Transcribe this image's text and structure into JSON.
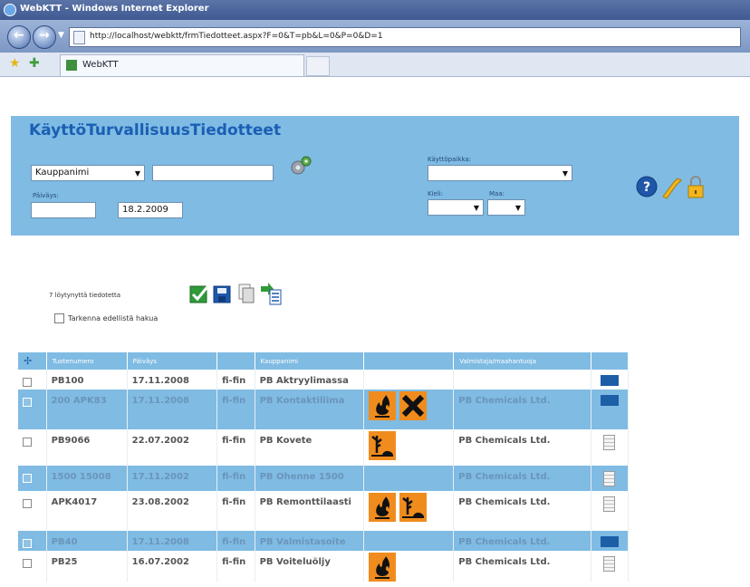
{
  "browser": {
    "window_title": "WebKTT - Windows Internet Explorer",
    "url": "http://localhost/webktt/frmTiedotteet.aspx?F=0&T=pb&L=0&P=0&D=1",
    "tab_label": "WebKTT"
  },
  "header": {
    "app_title": "KäyttöTurvallisuusTiedotteet",
    "search_field_select": "Kauppanimi",
    "search_text": "",
    "date_label": "Päiväys:",
    "date_from": "",
    "date_to": "18.2.2009",
    "usage_label": "Käyttöpaikka:",
    "usage_value": "",
    "kieli_label": "Kieli:",
    "kieli_value": "",
    "maa_label": "Maa:",
    "maa_value": ""
  },
  "info": {
    "selected_count": "7 löytynyttä tiedotetta",
    "checkbox_label": "Tarkenna edellistä hakua"
  },
  "table": {
    "headers": [
      "",
      "Tuotenumero",
      "Päiväys",
      "",
      "Kauppanimi",
      "",
      "Valmistaja/maahantuoja",
      ""
    ],
    "rows": [
      {
        "code": "PB100",
        "date": "17.11.2008",
        "lang": "fi-fin",
        "name": "PB Aktryylimassa",
        "maker": "",
        "doc": "blue",
        "hazards": []
      },
      {
        "code": "200 APK83",
        "date": "17.11.2008",
        "lang": "fi-fin",
        "name": "PB Kontaktiliima",
        "maker": "PB Chemicals Ltd.",
        "doc": "blue",
        "hazards": [
          "flame-icon",
          "harmful-x-icon"
        ]
      },
      {
        "code": "PB9066",
        "date": "22.07.2002",
        "lang": "fi-fin",
        "name": "PB Kovete",
        "maker": "PB Chemicals Ltd.",
        "doc": "page",
        "hazards": [
          "environment-icon"
        ]
      },
      {
        "code": "1500 15008",
        "date": "17.11.2002",
        "lang": "fi-fin",
        "name": "PB Ohenne 1500",
        "maker": "PB Chemicals Ltd.",
        "doc": "page",
        "hazards": []
      },
      {
        "code": "APK4017",
        "date": "23.08.2002",
        "lang": "fi-fin",
        "name": "PB Remonttilaasti",
        "maker": "PB Chemicals Ltd.",
        "doc": "page",
        "hazards": [
          "flame-icon",
          "environment-icon"
        ]
      },
      {
        "code": "PB40",
        "date": "17.11.2008",
        "lang": "fi-fin",
        "name": "PB Valmistasoite",
        "maker": "PB Chemicals Ltd.",
        "doc": "blue",
        "hazards": []
      },
      {
        "code": "PB25",
        "date": "16.07.2002",
        "lang": "fi-fin",
        "name": "PB Voiteluöljy",
        "maker": "PB Chemicals Ltd.",
        "doc": "page",
        "hazards": [
          "flame-icon"
        ]
      }
    ]
  },
  "colors": {
    "header_panel": "#7fbbe3",
    "title_blue": "#1a5fb4",
    "hazard_orange": "#f08c1e",
    "doc_blue": "#1d5fa6"
  }
}
